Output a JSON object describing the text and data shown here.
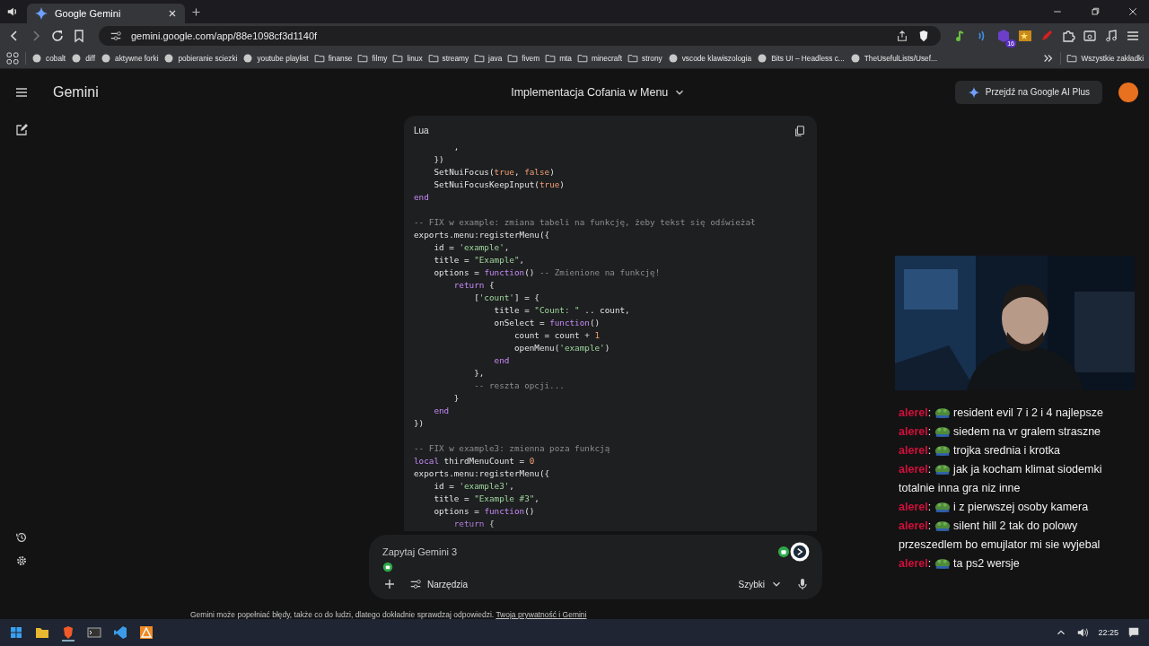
{
  "browser": {
    "tabs": [
      {
        "title": "Google Gemini",
        "selected": true
      }
    ],
    "address": "gemini.google.com/app/88e1098cf3d1140f",
    "extension_badge": "16",
    "bookmarks": [
      {
        "label": "cobalt",
        "kind": "site"
      },
      {
        "label": "diff",
        "kind": "site"
      },
      {
        "label": "aktywne forki",
        "kind": "site"
      },
      {
        "label": "pobieranie sciezki",
        "kind": "site"
      },
      {
        "label": "youtube playlist",
        "kind": "site"
      },
      {
        "label": "finanse",
        "kind": "folder"
      },
      {
        "label": "filmy",
        "kind": "folder"
      },
      {
        "label": "linux",
        "kind": "folder"
      },
      {
        "label": "streamy",
        "kind": "folder"
      },
      {
        "label": "java",
        "kind": "folder"
      },
      {
        "label": "fivem",
        "kind": "folder"
      },
      {
        "label": "mta",
        "kind": "folder"
      },
      {
        "label": "minecraft",
        "kind": "folder"
      },
      {
        "label": "strony",
        "kind": "folder"
      },
      {
        "label": "vscode klawiszologia",
        "kind": "site"
      },
      {
        "label": "Bits UI – Headless c...",
        "kind": "site"
      },
      {
        "label": "TheUsefulLists/Usef...",
        "kind": "site"
      }
    ],
    "all_bookmarks": "Wszystkie zakładki"
  },
  "gemini": {
    "logo": "Gemini",
    "conversation_title": "Implementacja Cofania w Menu",
    "upgrade_button": "Przejdź na Google AI Plus",
    "code_block": {
      "language": "Lua",
      "lines": [
        {
          "kind": "code",
          "tokens": [
            {
              "kind": "plain",
              "t": "        ,"
            }
          ]
        },
        {
          "kind": "code",
          "tokens": [
            {
              "kind": "plain",
              "t": "    })"
            }
          ]
        },
        {
          "kind": "code",
          "tokens": [
            {
              "kind": "plain",
              "t": "    SetNuiFocus("
            },
            {
              "kind": "number",
              "t": "true"
            },
            {
              "kind": "plain",
              "t": ", "
            },
            {
              "kind": "number",
              "t": "false"
            },
            {
              "kind": "plain",
              "t": ")"
            }
          ]
        },
        {
          "kind": "code",
          "tokens": [
            {
              "kind": "plain",
              "t": "    SetNuiFocusKeepInput("
            },
            {
              "kind": "number",
              "t": "true"
            },
            {
              "kind": "plain",
              "t": ")"
            }
          ]
        },
        {
          "kind": "code",
          "tokens": [
            {
              "kind": "keyword",
              "t": "end"
            }
          ]
        },
        {
          "kind": "blank"
        },
        {
          "kind": "code",
          "tokens": [
            {
              "kind": "comment",
              "t": "-- FIX w example: zmiana tabeli na funkcję, żeby tekst się odświeżał"
            }
          ]
        },
        {
          "kind": "code",
          "tokens": [
            {
              "kind": "plain",
              "t": "exports.menu:registerMenu({"
            }
          ]
        },
        {
          "kind": "code",
          "tokens": [
            {
              "kind": "plain",
              "t": "    id = "
            },
            {
              "kind": "string",
              "t": "'example'"
            },
            {
              "kind": "plain",
              "t": ","
            }
          ]
        },
        {
          "kind": "code",
          "tokens": [
            {
              "kind": "plain",
              "t": "    title = "
            },
            {
              "kind": "string",
              "t": "\"Example\""
            },
            {
              "kind": "plain",
              "t": ","
            }
          ]
        },
        {
          "kind": "code",
          "tokens": [
            {
              "kind": "plain",
              "t": "    options = "
            },
            {
              "kind": "keyword",
              "t": "function"
            },
            {
              "kind": "plain",
              "t": "() "
            },
            {
              "kind": "comment",
              "t": "-- Zmienione na funkcję!"
            }
          ]
        },
        {
          "kind": "code",
          "tokens": [
            {
              "kind": "keyword",
              "t": "        return"
            },
            {
              "kind": "plain",
              "t": " {"
            }
          ]
        },
        {
          "kind": "code",
          "tokens": [
            {
              "kind": "plain",
              "t": "            ["
            },
            {
              "kind": "string",
              "t": "'count'"
            },
            {
              "kind": "plain",
              "t": "] = {"
            }
          ]
        },
        {
          "kind": "code",
          "tokens": [
            {
              "kind": "plain",
              "t": "                title = "
            },
            {
              "kind": "string",
              "t": "\"Count: \""
            },
            {
              "kind": "plain",
              "t": " .. count,"
            }
          ]
        },
        {
          "kind": "code",
          "tokens": [
            {
              "kind": "plain",
              "t": "                onSelect = "
            },
            {
              "kind": "keyword",
              "t": "function"
            },
            {
              "kind": "plain",
              "t": "()"
            }
          ]
        },
        {
          "kind": "code",
          "tokens": [
            {
              "kind": "plain",
              "t": "                    count = count + "
            },
            {
              "kind": "number",
              "t": "1"
            }
          ]
        },
        {
          "kind": "code",
          "tokens": [
            {
              "kind": "plain",
              "t": "                    openMenu("
            },
            {
              "kind": "string",
              "t": "'example'"
            },
            {
              "kind": "plain",
              "t": ")"
            }
          ]
        },
        {
          "kind": "code",
          "tokens": [
            {
              "kind": "keyword",
              "t": "                end"
            }
          ]
        },
        {
          "kind": "code",
          "tokens": [
            {
              "kind": "plain",
              "t": "            },"
            }
          ]
        },
        {
          "kind": "code",
          "tokens": [
            {
              "kind": "comment",
              "t": "            -- reszta opcji..."
            }
          ]
        },
        {
          "kind": "code",
          "tokens": [
            {
              "kind": "plain",
              "t": "        }"
            }
          ]
        },
        {
          "kind": "code",
          "tokens": [
            {
              "kind": "keyword",
              "t": "    end"
            }
          ]
        },
        {
          "kind": "code",
          "tokens": [
            {
              "kind": "plain",
              "t": "})"
            }
          ]
        },
        {
          "kind": "blank"
        },
        {
          "kind": "code",
          "tokens": [
            {
              "kind": "comment",
              "t": "-- FIX w example3: zmienna poza funkcją"
            }
          ]
        },
        {
          "kind": "code",
          "tokens": [
            {
              "kind": "keyword",
              "t": "local"
            },
            {
              "kind": "plain",
              "t": " thirdMenuCount = "
            },
            {
              "kind": "number",
              "t": "0"
            }
          ]
        },
        {
          "kind": "code",
          "tokens": [
            {
              "kind": "plain",
              "t": "exports.menu:registerMenu({"
            }
          ]
        },
        {
          "kind": "code",
          "tokens": [
            {
              "kind": "plain",
              "t": "    id = "
            },
            {
              "kind": "string",
              "t": "'example3'"
            },
            {
              "kind": "plain",
              "t": ","
            }
          ]
        },
        {
          "kind": "code",
          "tokens": [
            {
              "kind": "plain",
              "t": "    title = "
            },
            {
              "kind": "string",
              "t": "\"Example #3\""
            },
            {
              "kind": "plain",
              "t": ","
            }
          ]
        },
        {
          "kind": "code",
          "tokens": [
            {
              "kind": "plain",
              "t": "    options = "
            },
            {
              "kind": "keyword",
              "t": "function"
            },
            {
              "kind": "plain",
              "t": "()"
            }
          ]
        },
        {
          "kind": "code",
          "tokens": [
            {
              "kind": "keyword",
              "t": "        return"
            },
            {
              "kind": "plain",
              "t": " {"
            }
          ]
        }
      ]
    },
    "prompt": {
      "placeholder": "Zapytaj Gemini 3",
      "tools": "Narzędzia",
      "mode": "Szybki"
    },
    "disclaimer": "Gemini może popełniać błędy, także co do ludzi, dlatego dokładnie sprawdzaj odpowiedzi.",
    "privacy_link": "Twoja prywatność i Gemini"
  },
  "stream_chat": [
    {
      "user": "alerel",
      "separator": ":",
      "text": "resident evil 7 i 2 i 4 najlepsze"
    },
    {
      "user": "alerel",
      "separator": ":",
      "text": "siedem na vr gralem straszne"
    },
    {
      "user": "alerel",
      "separator": ":",
      "text": "trojka srednia i krotka"
    },
    {
      "user": "alerel",
      "separator": ":",
      "text": "jak ja kocham klimat siodemki totalnie inna gra niz inne"
    },
    {
      "user": "alerel",
      "separator": ":",
      "text": "i z pierwszej osoby kamera"
    },
    {
      "user": "alerel",
      "separator": ":",
      "text": "silent hill 2 tak do polowy przeszedlem bo emujlator mi sie wyjebal"
    },
    {
      "user": "alerel",
      "separator": ":",
      "text": "ta ps2 wersje"
    }
  ],
  "taskbar": {
    "clock": "22:25"
  }
}
